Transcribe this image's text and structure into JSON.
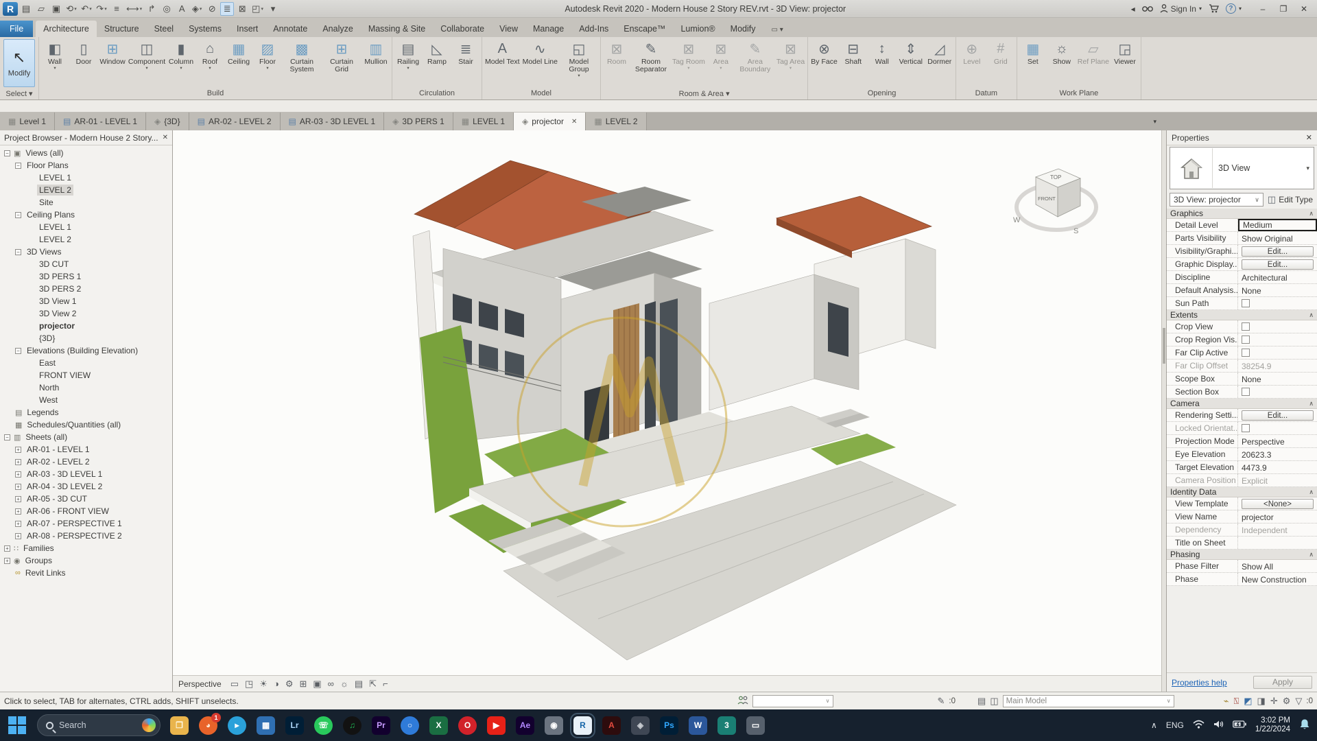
{
  "app": {
    "title": "Autodesk Revit 2020 - Modern House 2 Story REV.rvt - 3D View: projector",
    "sign_in_label": "Sign In",
    "collapse_glyph": "◂",
    "help_glyph": "?",
    "window_controls": {
      "minimize": "–",
      "restore": "❐",
      "close": "✕"
    },
    "dropdown_glyph": "▾"
  },
  "qat": {
    "items": [
      {
        "name": "revit-logo",
        "glyph": "R",
        "logo": true
      },
      {
        "name": "properties-toggle",
        "glyph": "▤"
      },
      {
        "name": "open",
        "glyph": "▱"
      },
      {
        "name": "save",
        "glyph": "▣"
      },
      {
        "name": "sync",
        "glyph": "⟲",
        "dropdown": true
      },
      {
        "name": "undo",
        "glyph": "↶",
        "dropdown": true
      },
      {
        "name": "redo",
        "glyph": "↷",
        "dropdown": true
      },
      {
        "name": "print",
        "glyph": "≡"
      },
      {
        "name": "measure",
        "glyph": "⟷",
        "dropdown": true
      },
      {
        "name": "aligned-dimension",
        "glyph": "↱"
      },
      {
        "name": "tag",
        "glyph": "◎"
      },
      {
        "name": "text",
        "glyph": "A"
      },
      {
        "name": "default-3d-view",
        "glyph": "◈",
        "dropdown": true
      },
      {
        "name": "section",
        "glyph": "⊘"
      },
      {
        "name": "thin-lines",
        "glyph": "≣",
        "active": true
      },
      {
        "name": "close-hidden-windows",
        "glyph": "⊠"
      },
      {
        "name": "switch-windows",
        "glyph": "◰",
        "dropdown": true
      },
      {
        "name": "customize-qat",
        "glyph": "▾"
      }
    ]
  },
  "ribbon": {
    "file_tab": "File",
    "tabs": [
      "Architecture",
      "Structure",
      "Steel",
      "Systems",
      "Insert",
      "Annotate",
      "Analyze",
      "Massing & Site",
      "Collaborate",
      "View",
      "Manage",
      "Add-Ins",
      "Enscape™",
      "Lumion®",
      "Modify"
    ],
    "active_tab": "Architecture",
    "panel_toggle_glyph": "▭ ▾",
    "modify_label": "Modify",
    "modify_icon": "↖",
    "select_panel_label": "Select ▾",
    "panels": [
      {
        "label": "Build",
        "buttons": [
          {
            "label": "Wall",
            "icon": "◧",
            "dropdown": true
          },
          {
            "label": "Door",
            "icon": "▯"
          },
          {
            "label": "Window",
            "icon": "⊞",
            "blue": true
          },
          {
            "label": "Component",
            "icon": "◫",
            "dropdown": true
          },
          {
            "label": "Column",
            "icon": "▮",
            "dropdown": true
          },
          {
            "label": "Roof",
            "icon": "⌂",
            "dropdown": true
          },
          {
            "label": "Ceiling",
            "icon": "▦",
            "blue": true
          },
          {
            "label": "Floor",
            "icon": "▨",
            "blue": true,
            "dropdown": true
          },
          {
            "label": "Curtain System",
            "icon": "▩",
            "blue": true
          },
          {
            "label": "Curtain Grid",
            "icon": "⊞",
            "blue": true
          },
          {
            "label": "Mullion",
            "icon": "▥",
            "blue": true
          }
        ]
      },
      {
        "label": "Circulation",
        "buttons": [
          {
            "label": "Railing",
            "icon": "▤",
            "dropdown": true
          },
          {
            "label": "Ramp",
            "icon": "◺"
          },
          {
            "label": "Stair",
            "icon": "≣"
          }
        ]
      },
      {
        "label": "Model",
        "buttons": [
          {
            "label": "Model Text",
            "icon": "A"
          },
          {
            "label": "Model Line",
            "icon": "∿"
          },
          {
            "label": "Model Group",
            "icon": "◱",
            "dropdown": true
          }
        ]
      },
      {
        "label": "Room & Area",
        "panel_dropdown": true,
        "buttons": [
          {
            "label": "Room",
            "icon": "⊠",
            "disabled": true
          },
          {
            "label": "Room Separator",
            "icon": "✎"
          },
          {
            "label": "Tag Room",
            "icon": "⊠",
            "dropdown": true,
            "disabled": true
          },
          {
            "label": "Area",
            "icon": "⊠",
            "dropdown": true,
            "disabled": true
          },
          {
            "label": "Area Boundary",
            "icon": "✎",
            "disabled": true
          },
          {
            "label": "Tag Area",
            "icon": "⊠",
            "dropdown": true,
            "disabled": true
          }
        ]
      },
      {
        "label": "Opening",
        "buttons": [
          {
            "label": "By Face",
            "icon": "⊗"
          },
          {
            "label": "Shaft",
            "icon": "⊟"
          },
          {
            "label": "Wall",
            "icon": "↕"
          },
          {
            "label": "Vertical",
            "icon": "⇕"
          },
          {
            "label": "Dormer",
            "icon": "◿"
          }
        ]
      },
      {
        "label": "Datum",
        "buttons": [
          {
            "label": "Level",
            "icon": "⊕",
            "disabled": true
          },
          {
            "label": "Grid",
            "icon": "#",
            "disabled": true
          }
        ]
      },
      {
        "label": "Work Plane",
        "buttons": [
          {
            "label": "Set",
            "icon": "▦",
            "blue": true
          },
          {
            "label": "Show",
            "icon": "☼"
          },
          {
            "label": "Ref Plane",
            "icon": "▱",
            "disabled": true
          },
          {
            "label": "Viewer",
            "icon": "◲"
          }
        ]
      }
    ]
  },
  "view_tabs": {
    "overflow_glyph": "▾",
    "close_glyph": "✕",
    "tabs": [
      {
        "label": "Level 1",
        "icon": "plan"
      },
      {
        "label": "AR-01 - LEVEL 1",
        "icon": "sheet"
      },
      {
        "label": "{3D}",
        "icon": "3d"
      },
      {
        "label": "AR-02 - LEVEL 2",
        "icon": "sheet"
      },
      {
        "label": "AR-03 - 3D LEVEL 1",
        "icon": "sheet"
      },
      {
        "label": "3D PERS 1",
        "icon": "3d"
      },
      {
        "label": "LEVEL 1",
        "icon": "plan"
      },
      {
        "label": "projector",
        "icon": "3d",
        "active": true,
        "closable": true
      },
      {
        "label": "LEVEL 2",
        "icon": "plan"
      }
    ]
  },
  "project_browser": {
    "title": "Project Browser - Modern House 2 Story...",
    "close_glyph": "✕",
    "tree": [
      {
        "label": "Views (all)",
        "level": 0,
        "expand": "minus",
        "icon": "▣"
      },
      {
        "label": "Floor Plans",
        "level": 1,
        "expand": "minus"
      },
      {
        "label": "LEVEL 1",
        "level": 2
      },
      {
        "label": "LEVEL 2",
        "level": 2,
        "selected": true
      },
      {
        "label": "Site",
        "level": 2
      },
      {
        "label": "Ceiling Plans",
        "level": 1,
        "expand": "minus"
      },
      {
        "label": "LEVEL 1",
        "level": 2
      },
      {
        "label": "LEVEL 2",
        "level": 2
      },
      {
        "label": "3D Views",
        "level": 1,
        "expand": "minus"
      },
      {
        "label": "3D CUT",
        "level": 2
      },
      {
        "label": "3D PERS 1",
        "level": 2
      },
      {
        "label": "3D PERS 2",
        "level": 2
      },
      {
        "label": "3D View 1",
        "level": 2
      },
      {
        "label": "3D View 2",
        "level": 2
      },
      {
        "label": "projector",
        "level": 2,
        "bold": true
      },
      {
        "label": "{3D}",
        "level": 2
      },
      {
        "label": "Elevations (Building Elevation)",
        "level": 1,
        "expand": "minus"
      },
      {
        "label": "East",
        "level": 2
      },
      {
        "label": "FRONT VIEW",
        "level": 2
      },
      {
        "label": "North",
        "level": 2
      },
      {
        "label": "West",
        "level": 2
      },
      {
        "label": "Legends",
        "level": 0,
        "icon": "▤"
      },
      {
        "label": "Schedules/Quantities (all)",
        "level": 0,
        "icon": "▦"
      },
      {
        "label": "Sheets (all)",
        "level": 0,
        "expand": "minus",
        "icon": "▥"
      },
      {
        "label": "AR-01 - LEVEL 1",
        "level": 1,
        "expand": "plus"
      },
      {
        "label": "AR-02 - LEVEL 2",
        "level": 1,
        "expand": "plus"
      },
      {
        "label": "AR-03 - 3D LEVEL 1",
        "level": 1,
        "expand": "plus"
      },
      {
        "label": "AR-04 - 3D LEVEL 2",
        "level": 1,
        "expand": "plus"
      },
      {
        "label": "AR-05 - 3D CUT",
        "level": 1,
        "expand": "plus"
      },
      {
        "label": "AR-06 - FRONT VIEW",
        "level": 1,
        "expand": "plus"
      },
      {
        "label": "AR-07 - PERSPECTIVE 1",
        "level": 1,
        "expand": "plus"
      },
      {
        "label": "AR-08 - PERSPECTIVE 2",
        "level": 1,
        "expand": "plus"
      },
      {
        "label": "Families",
        "level": 0,
        "expand": "plus",
        "icon": "∷"
      },
      {
        "label": "Groups",
        "level": 0,
        "expand": "plus",
        "icon": "◉"
      },
      {
        "label": "Revit Links",
        "level": 0,
        "icon": "∞",
        "gold": true
      }
    ]
  },
  "viewport": {
    "viewcube": {
      "top": "TOP",
      "front": "FRONT",
      "west": "W",
      "south": "S"
    },
    "palette": {
      "roof": "#bc6240",
      "grass": "#7aa33d",
      "wall_light": "#e9e8e4",
      "wall_mid": "#cfcec9",
      "glass": "#41474d",
      "wood": "#a87f4e",
      "paving": "#d6d5cf",
      "watermark_gold": "#c9a22a"
    },
    "view_control_bar": {
      "scale_label": "Perspective",
      "icons": [
        {
          "name": "detail-level",
          "glyph": "▭"
        },
        {
          "name": "visual-style",
          "glyph": "◳"
        },
        {
          "name": "sun-path",
          "glyph": "☀"
        },
        {
          "name": "shadows",
          "glyph": "◑"
        },
        {
          "name": "rendering-dialog",
          "glyph": "⚙"
        },
        {
          "name": "crop-view",
          "glyph": "⊞"
        },
        {
          "name": "crop-region",
          "glyph": "▣"
        },
        {
          "name": "temporary-hide-isolate",
          "glyph": "∞"
        },
        {
          "name": "reveal-hidden",
          "glyph": "☼"
        },
        {
          "name": "temporary-view-properties",
          "glyph": "▤"
        },
        {
          "name": "displaced-elements",
          "glyph": "⇱"
        },
        {
          "name": "reveal-constraints",
          "glyph": "⌐"
        }
      ]
    }
  },
  "properties": {
    "title": "Properties",
    "close_glyph": "✕",
    "type_name": "3D View",
    "instance_combo": "3D View: projector",
    "combo_chevron": "∨",
    "edit_type_label": "Edit Type",
    "collapse_glyph": "∧",
    "sections": [
      {
        "title": "Graphics",
        "rows": [
          {
            "label": "Detail Level",
            "value": "Medium",
            "style": "focused"
          },
          {
            "label": "Parts Visibility",
            "value": "Show Original"
          },
          {
            "label": "Visibility/Graphi...",
            "value": "Edit...",
            "style": "button"
          },
          {
            "label": "Graphic Display...",
            "value": "Edit...",
            "style": "button"
          },
          {
            "label": "Discipline",
            "value": "Architectural"
          },
          {
            "label": "Default Analysis...",
            "value": "None"
          },
          {
            "label": "Sun Path",
            "value": "",
            "style": "checkbox"
          }
        ]
      },
      {
        "title": "Extents",
        "rows": [
          {
            "label": "Crop View",
            "value": "",
            "style": "checkbox"
          },
          {
            "label": "Crop Region Vis...",
            "value": "",
            "style": "checkbox"
          },
          {
            "label": "Far Clip Active",
            "value": "",
            "style": "checkbox"
          },
          {
            "label": "Far Clip Offset",
            "value": "38254.9",
            "style": "disabled"
          },
          {
            "label": "Scope Box",
            "value": "None"
          },
          {
            "label": "Section Box",
            "value": "",
            "style": "checkbox"
          }
        ]
      },
      {
        "title": "Camera",
        "rows": [
          {
            "label": "Rendering Setti...",
            "value": "Edit...",
            "style": "button"
          },
          {
            "label": "Locked Orientat...",
            "value": "",
            "style": "checkbox-disabled"
          },
          {
            "label": "Projection Mode",
            "value": "Perspective"
          },
          {
            "label": "Eye Elevation",
            "value": "20623.3"
          },
          {
            "label": "Target Elevation",
            "value": "4473.9"
          },
          {
            "label": "Camera Position",
            "value": "Explicit",
            "style": "disabled"
          }
        ]
      },
      {
        "title": "Identity Data",
        "rows": [
          {
            "label": "View Template",
            "value": "<None>",
            "style": "button"
          },
          {
            "label": "View Name",
            "value": "projector"
          },
          {
            "label": "Dependency",
            "value": "Independent",
            "style": "disabled"
          },
          {
            "label": "Title on Sheet",
            "value": ""
          }
        ]
      },
      {
        "title": "Phasing",
        "rows": [
          {
            "label": "Phase Filter",
            "value": "Show All"
          },
          {
            "label": "Phase",
            "value": "New Construction"
          }
        ]
      }
    ],
    "help_link": "Properties help",
    "apply_label": "Apply"
  },
  "status_bar": {
    "prompt": "Click to select, TAB for alternates, CTRL adds, SHIFT unselects.",
    "workset_combo": "",
    "editable_only_count": ":0",
    "design_option_label": "Main Model",
    "selection_count": ":0",
    "icons_left": [
      {
        "name": "worksets",
        "glyph": "⚇"
      },
      {
        "name": "editable-only-filter",
        "glyph": "✎"
      }
    ],
    "icons_mid": [
      {
        "name": "design-options",
        "glyph": "▤"
      },
      {
        "name": "exclude-options",
        "glyph": "◫"
      }
    ],
    "icons_right": [
      {
        "name": "select-links",
        "glyph": "⌁",
        "tint": "gold"
      },
      {
        "name": "select-underlay",
        "glyph": "⍂",
        "tint": "red"
      },
      {
        "name": "select-pinned",
        "glyph": "◩",
        "tint": "blue"
      },
      {
        "name": "select-by-face",
        "glyph": "◨"
      },
      {
        "name": "drag-on-selection",
        "glyph": "✛"
      },
      {
        "name": "background-processes",
        "glyph": "⚙"
      },
      {
        "name": "selection-filter",
        "glyph": "▽"
      }
    ]
  },
  "taskbar": {
    "search_placeholder": "Search",
    "apps": [
      {
        "name": "file-explorer",
        "glyph": "❒",
        "bg": "#e9b44c",
        "fg": "#fff7e0"
      },
      {
        "name": "browser-orange",
        "glyph": "◕",
        "bg": "#e8632a",
        "fg": "#ffe9d6",
        "shape": "circle",
        "badge": "1"
      },
      {
        "name": "telegram",
        "glyph": "▸",
        "bg": "#2aa1da",
        "fg": "#ffffff",
        "shape": "circle"
      },
      {
        "name": "app-blue",
        "glyph": "▦",
        "bg": "#2f6fb2",
        "fg": "#ffffff"
      },
      {
        "name": "lightroom-classic",
        "glyph": "Lr",
        "bg": "#001e36",
        "fg": "#add5f7"
      },
      {
        "name": "whatsapp",
        "glyph": "☏",
        "bg": "#29c95c",
        "fg": "#ffffff",
        "shape": "circle"
      },
      {
        "name": "spotify",
        "glyph": "♫",
        "bg": "#121212",
        "fg": "#1db954",
        "shape": "circle"
      },
      {
        "name": "premiere-pro",
        "glyph": "Pr",
        "bg": "#12002e",
        "fg": "#c79bff"
      },
      {
        "name": "browser-blue",
        "glyph": "○",
        "bg": "#2f7bd9",
        "fg": "#ffffff",
        "shape": "circle"
      },
      {
        "name": "excel",
        "glyph": "X",
        "bg": "#1a6e42",
        "fg": "#ffffff"
      },
      {
        "name": "opera",
        "glyph": "O",
        "bg": "#d1222a",
        "fg": "#ffffff",
        "shape": "circle"
      },
      {
        "name": "youtube",
        "glyph": "▶",
        "bg": "#e62117",
        "fg": "#ffffff"
      },
      {
        "name": "after-effects",
        "glyph": "Ae",
        "bg": "#12002e",
        "fg": "#b388ff"
      },
      {
        "name": "camera-app",
        "glyph": "◉",
        "bg": "#6b7480",
        "fg": "#ffffff"
      },
      {
        "name": "revit",
        "glyph": "R",
        "bg": "#e9f1f8",
        "fg": "#1565a8",
        "active": true
      },
      {
        "name": "autocad",
        "glyph": "A",
        "bg": "#2d0c0d",
        "fg": "#e44a3e"
      },
      {
        "name": "app-grey",
        "glyph": "◈",
        "bg": "#3f4754",
        "fg": "#c9cdd2"
      },
      {
        "name": "photoshop",
        "glyph": "Ps",
        "bg": "#001e36",
        "fg": "#31a8ff"
      },
      {
        "name": "word",
        "glyph": "W",
        "bg": "#2b579a",
        "fg": "#ffffff"
      },
      {
        "name": "3ds-max",
        "glyph": "3",
        "bg": "#1a7f74",
        "fg": "#ffffff"
      },
      {
        "name": "monitor-app",
        "glyph": "▭",
        "bg": "#56606c",
        "fg": "#ffffff"
      }
    ],
    "tray": {
      "chevron": "∧",
      "language": "ENG",
      "time": "3:02 PM",
      "date": "1/22/2024"
    }
  }
}
